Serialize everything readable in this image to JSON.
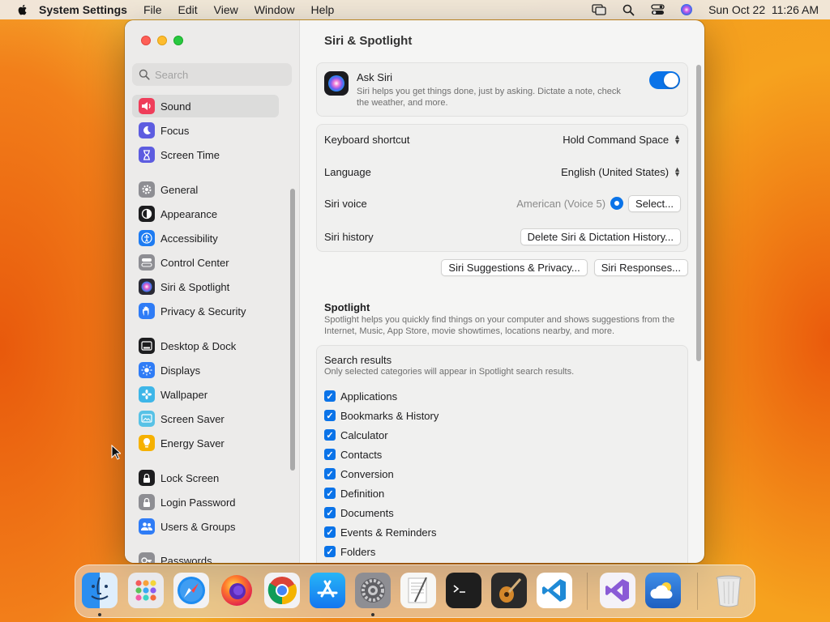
{
  "menubar": {
    "app_name": "System Settings",
    "menus": [
      "File",
      "Edit",
      "View",
      "Window",
      "Help"
    ],
    "clock": "Sun Oct 22  11:26 AM",
    "status_icons": [
      "screen-mirroring-icon",
      "spotlight-search-icon",
      "control-center-icon",
      "siri-icon"
    ]
  },
  "sidebar": {
    "search_placeholder": "Search",
    "items": [
      {
        "label": "Sound",
        "icon": "speaker-icon",
        "color": "#ef3d5a",
        "selected": true
      },
      {
        "label": "Focus",
        "icon": "moon-icon",
        "color": "#5d5ce0"
      },
      {
        "label": "Screen Time",
        "icon": "hourglass-icon",
        "color": "#5d5ce0"
      },
      {
        "label": "General",
        "icon": "gear-icon",
        "color": "#8e8e93"
      },
      {
        "label": "Appearance",
        "icon": "appearance-icon",
        "color": "#1d1d1f"
      },
      {
        "label": "Accessibility",
        "icon": "accessibility-icon",
        "color": "#1e7cf2"
      },
      {
        "label": "Control Center",
        "icon": "control-center-icon",
        "color": "#8e8e93"
      },
      {
        "label": "Siri & Spotlight",
        "icon": "siri-icon",
        "color": "#2a2a35"
      },
      {
        "label": "Privacy & Security",
        "icon": "hand-icon",
        "color": "#2f7cf6"
      },
      {
        "label": "Desktop & Dock",
        "icon": "dock-icon",
        "color": "#1d1d1f"
      },
      {
        "label": "Displays",
        "icon": "sun-icon",
        "color": "#2f7cf6"
      },
      {
        "label": "Wallpaper",
        "icon": "flower-icon",
        "color": "#3eb6e8"
      },
      {
        "label": "Screen Saver",
        "icon": "screensaver-icon",
        "color": "#58c2e6"
      },
      {
        "label": "Energy Saver",
        "icon": "lightbulb-icon",
        "color": "#f6b100"
      },
      {
        "label": "Lock Screen",
        "icon": "lock-icon",
        "color": "#1d1d1f"
      },
      {
        "label": "Login Password",
        "icon": "lock-icon",
        "color": "#8e8e93"
      },
      {
        "label": "Users & Groups",
        "icon": "users-icon",
        "color": "#2f7cf6"
      },
      {
        "label": "Passwords",
        "icon": "key-icon",
        "color": "#8e8e93"
      }
    ]
  },
  "content": {
    "title": "Siri & Spotlight",
    "ask_siri": {
      "title": "Ask Siri",
      "description": "Siri helps you get things done, just by asking. Dictate a note, check the weather, and more.",
      "enabled": true
    },
    "settings": {
      "keyboard_shortcut_label": "Keyboard shortcut",
      "keyboard_shortcut_value": "Hold Command Space",
      "language_label": "Language",
      "language_value": "English (United States)",
      "voice_label": "Siri voice",
      "voice_value": "American (Voice 5)",
      "voice_select_button": "Select...",
      "history_label": "Siri history",
      "history_button": "Delete Siri & Dictation History..."
    },
    "suggestions_button": "Siri Suggestions & Privacy...",
    "responses_button": "Siri Responses...",
    "spotlight": {
      "title": "Spotlight",
      "description": "Spotlight helps you quickly find things on your computer and shows suggestions from the Internet, Music, App Store, movie showtimes, locations nearby, and more."
    },
    "search_results": {
      "title": "Search results",
      "subtitle": "Only selected categories will appear in Spotlight search results.",
      "items": [
        {
          "label": "Applications",
          "checked": true
        },
        {
          "label": "Bookmarks & History",
          "checked": true
        },
        {
          "label": "Calculator",
          "checked": true
        },
        {
          "label": "Contacts",
          "checked": true
        },
        {
          "label": "Conversion",
          "checked": true
        },
        {
          "label": "Definition",
          "checked": true
        },
        {
          "label": "Documents",
          "checked": true
        },
        {
          "label": "Events & Reminders",
          "checked": true
        },
        {
          "label": "Folders",
          "checked": true
        }
      ]
    }
  },
  "dock": {
    "apps": [
      {
        "name": "finder-icon",
        "running": true
      },
      {
        "name": "launchpad-icon",
        "running": false
      },
      {
        "name": "safari-icon",
        "running": false
      },
      {
        "name": "firefox-icon",
        "running": false
      },
      {
        "name": "chrome-icon",
        "running": false
      },
      {
        "name": "app-store-icon",
        "running": false
      },
      {
        "name": "system-settings-icon",
        "running": true
      },
      {
        "name": "script-editor-icon",
        "running": false
      },
      {
        "name": "terminal-icon",
        "running": false
      },
      {
        "name": "garageband-icon",
        "running": false
      },
      {
        "name": "vscode-icon",
        "running": false
      },
      {
        "name": "visual-studio-icon",
        "running": false
      },
      {
        "name": "weather-icon",
        "running": false
      },
      {
        "name": "trash-icon",
        "running": false
      }
    ]
  }
}
